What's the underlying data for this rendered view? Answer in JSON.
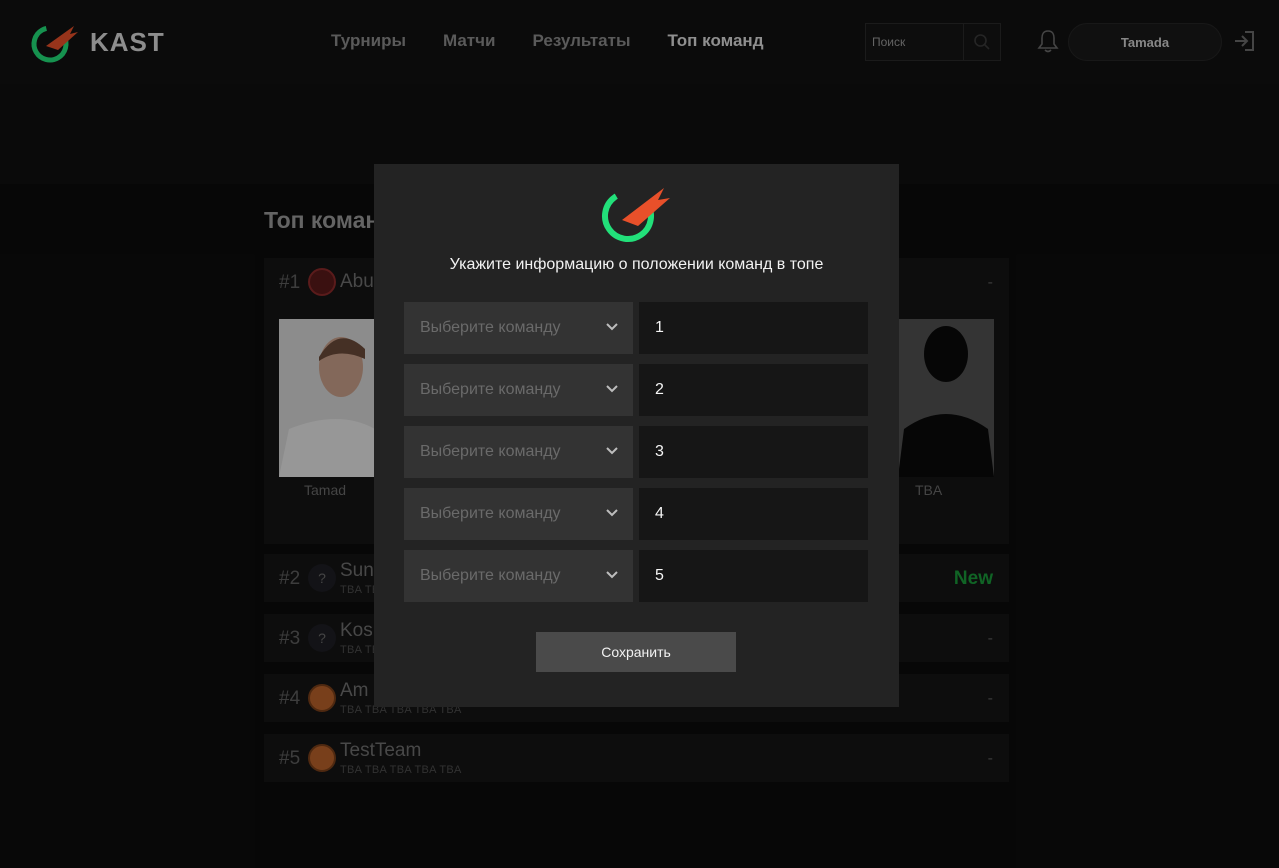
{
  "header": {
    "brand": "KAST",
    "nav": [
      "Турниры",
      "Матчи",
      "Результаты",
      "Топ команд"
    ],
    "active_nav": "Топ команд",
    "search_placeholder": "Поиск",
    "user_name": "Tamada"
  },
  "page": {
    "title": "Топ коман",
    "teams": [
      {
        "rank": "#1",
        "name": "Abu",
        "status": "-"
      },
      {
        "rank": "#2",
        "name": "Sun",
        "players": "TBA TBA",
        "status": "New"
      },
      {
        "rank": "#3",
        "name": "Kos",
        "players": "TBA TBA",
        "status": "-"
      },
      {
        "rank": "#4",
        "name": "Am",
        "players": "TBA TBA TBA TBA TBA",
        "status": "-"
      },
      {
        "rank": "#5",
        "name": "TestTeam",
        "players": "TBA TBA TBA TBA TBA",
        "status": "-"
      }
    ],
    "players": [
      {
        "label": "Tamad"
      },
      {
        "label": "TBA"
      }
    ]
  },
  "modal": {
    "title": "Укажите информацию о положении команд в топе",
    "rows": [
      {
        "select_placeholder": "Выберите команду",
        "position": "1"
      },
      {
        "select_placeholder": "Выберите команду",
        "position": "2"
      },
      {
        "select_placeholder": "Выберите команду",
        "position": "3"
      },
      {
        "select_placeholder": "Выберите команду",
        "position": "4"
      },
      {
        "select_placeholder": "Выберите команду",
        "position": "5"
      }
    ],
    "save_label": "Сохранить"
  },
  "colors": {
    "accent_green": "#22e07a",
    "accent_orange": "#e8502a",
    "new_badge": "#1a9a3a"
  }
}
